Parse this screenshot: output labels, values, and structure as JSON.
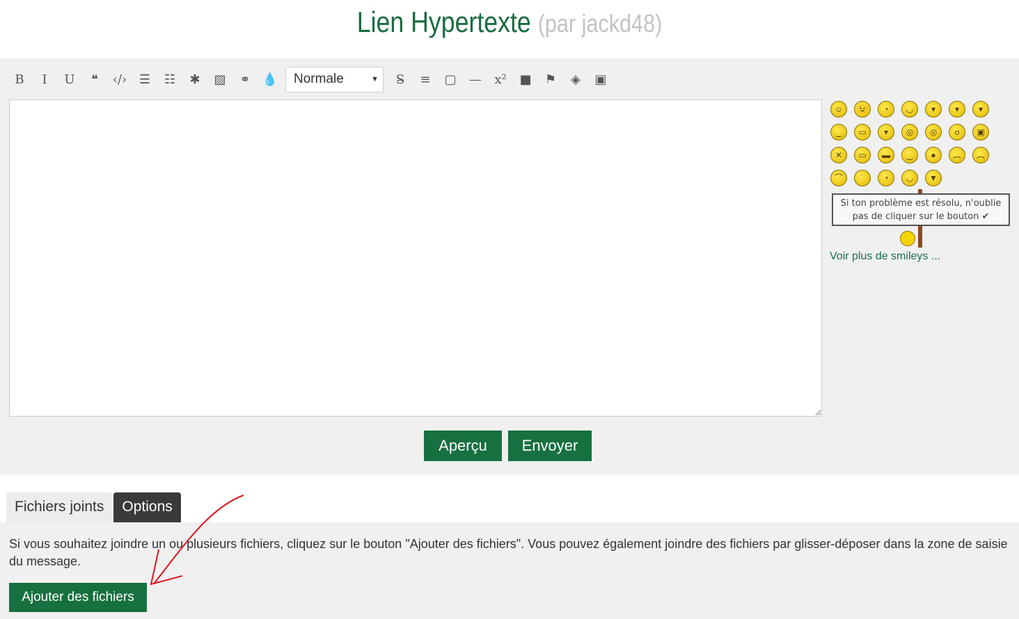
{
  "title": {
    "main": "Lien Hypertexte",
    "author": "(par jackd48)"
  },
  "toolbar": {
    "items": [
      {
        "icon": "bold-icon",
        "glyph": "B"
      },
      {
        "icon": "italic-icon",
        "glyph": "I"
      },
      {
        "icon": "underline-icon",
        "glyph": "U"
      },
      {
        "icon": "quote-icon",
        "glyph": "❝"
      },
      {
        "icon": "code-icon",
        "glyph": "‹/›"
      },
      {
        "icon": "bullet-list-icon",
        "glyph": "☰"
      },
      {
        "icon": "numbered-list-icon",
        "glyph": "☷"
      },
      {
        "icon": "asterisk-icon",
        "glyph": "✱"
      },
      {
        "icon": "image-icon",
        "glyph": "▨"
      },
      {
        "icon": "link-icon",
        "glyph": "⚭"
      },
      {
        "icon": "color-drop-icon",
        "glyph": "💧"
      }
    ],
    "format_select": "Normale",
    "items2": [
      {
        "icon": "strikethrough-icon",
        "glyph": "S̶"
      },
      {
        "icon": "align-center-icon",
        "glyph": "≡"
      },
      {
        "icon": "border-box-icon",
        "glyph": "▢"
      },
      {
        "icon": "horizontal-rule-icon",
        "glyph": "—"
      },
      {
        "icon": "superscript-icon",
        "glyph": "x²"
      },
      {
        "icon": "spoiler-box-icon",
        "glyph": "■"
      },
      {
        "icon": "flag-icon",
        "glyph": "⚑"
      },
      {
        "icon": "hide-icon",
        "glyph": "◈"
      },
      {
        "icon": "youtube-icon",
        "glyph": "▣"
      }
    ]
  },
  "smileys": [
    "☺",
    "😉",
    "◔",
    "◡",
    "▾",
    "▾",
    "▾",
    "‿",
    "▭",
    "▾",
    "◎",
    "◎",
    "o",
    "▣",
    "✕",
    "▭",
    "▬",
    "‿",
    "●",
    "︵",
    "︵",
    "⌒",
    "˙",
    "◔",
    "◡",
    "▼"
  ],
  "sign": {
    "line1": "Si ton problème est résolu, n'oublie",
    "line2": "pas de cliquer sur le bouton ✔"
  },
  "more_smileys": "Voir plus de smileys ...",
  "buttons": {
    "preview": "Aperçu",
    "send": "Envoyer",
    "add_files": "Ajouter des fichiers"
  },
  "tabs": [
    "Fichiers joints",
    "Options"
  ],
  "attachments": {
    "text": "Si vous souhaitez joindre un ou plusieurs fichiers, cliquez sur le bouton \"Ajouter des fichiers\". Vous pouvez également joindre des fichiers par glisser-déposer dans la zone de saisie du message."
  },
  "colors": {
    "brand": "#17703f",
    "annotation": "#e0151b"
  }
}
